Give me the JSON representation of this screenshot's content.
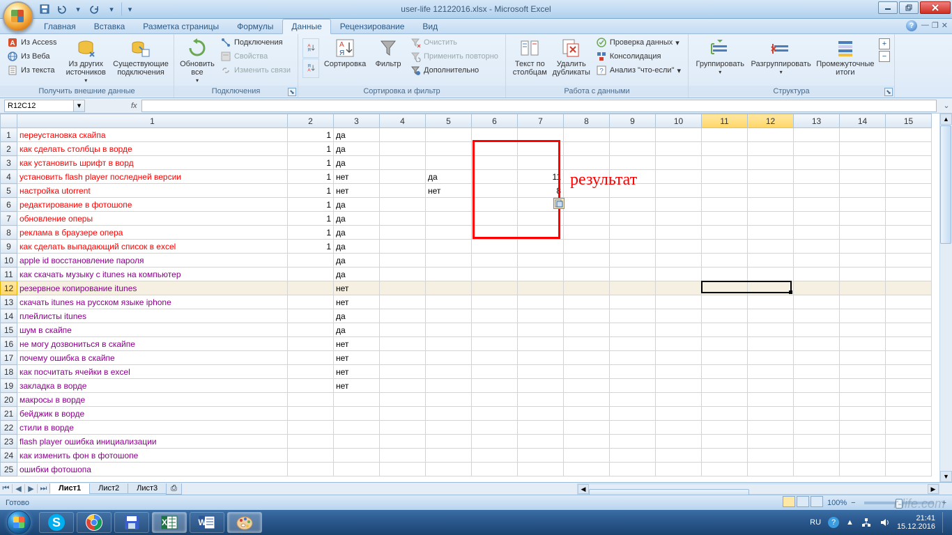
{
  "title": "user-life 12122016.xlsx - Microsoft Excel",
  "qat": {
    "save": "save",
    "undo": "undo",
    "redo": "redo"
  },
  "tabs": {
    "items": [
      {
        "label": "Главная"
      },
      {
        "label": "Вставка"
      },
      {
        "label": "Разметка страницы"
      },
      {
        "label": "Формулы"
      },
      {
        "label": "Данные"
      },
      {
        "label": "Рецензирование"
      },
      {
        "label": "Вид"
      }
    ],
    "active": 4
  },
  "ribbon": {
    "g1": {
      "access": "Из Access",
      "web": "Из Веба",
      "text": "Из текста",
      "other": "Из других источников",
      "existing": "Существующие подключения",
      "label": "Получить внешние данные"
    },
    "g2": {
      "refresh": "Обновить все",
      "conns": "Подключения",
      "props": "Свойства",
      "edit": "Изменить связи",
      "label": "Подключения"
    },
    "g3": {
      "az": "А↓Я",
      "za": "Я↓А",
      "sort": "Сортировка",
      "filter": "Фильтр",
      "clear": "Очистить",
      "reapply": "Применить повторно",
      "advanced": "Дополнительно",
      "label": "Сортировка и фильтр"
    },
    "g4": {
      "ttc": "Текст по столбцам",
      "dup": "Удалить дубликаты",
      "valid": "Проверка данных",
      "consol": "Консолидация",
      "whatif": "Анализ \"что-если\"",
      "label": "Работа с данными"
    },
    "g5": {
      "group": "Группировать",
      "ungroup": "Разгруппировать",
      "subtotal": "Промежуточные итоги",
      "label": "Структура"
    }
  },
  "namebox": "R12C12",
  "fx": "fx",
  "columns": [
    "",
    "1",
    "2",
    "3",
    "4",
    "5",
    "6",
    "7",
    "8",
    "9",
    "10",
    "11",
    "12",
    "13",
    "14",
    "15"
  ],
  "rows": [
    {
      "n": "1",
      "a": "переустановка скайпа",
      "cls": "c-red",
      "c2": "1",
      "c3": "да"
    },
    {
      "n": "2",
      "a": "как сделать столбцы в ворде",
      "cls": "c-red",
      "c2": "1",
      "c3": "да"
    },
    {
      "n": "3",
      "a": "как установить шрифт в ворд",
      "cls": "c-red",
      "c2": "1",
      "c3": "да"
    },
    {
      "n": "4",
      "a": "установить flash player последней версии",
      "cls": "c-red",
      "c2": "1",
      "c3": "нет",
      "c5": "да",
      "c7": "11"
    },
    {
      "n": "5",
      "a": "настройка utorrent",
      "cls": "c-red",
      "c2": "1",
      "c3": "нет",
      "c5": "нет",
      "c7": "8"
    },
    {
      "n": "6",
      "a": "редактирование в фотошопе",
      "cls": "c-red",
      "c2": "1",
      "c3": "да"
    },
    {
      "n": "7",
      "a": "обновление оперы",
      "cls": "c-red",
      "c2": "1",
      "c3": "да"
    },
    {
      "n": "8",
      "a": "реклама в браузере опера",
      "cls": "c-red",
      "c2": "1",
      "c3": "да"
    },
    {
      "n": "9",
      "a": "как сделать выпадающий список в excel",
      "cls": "c-red",
      "c2": "1",
      "c3": "да"
    },
    {
      "n": "10",
      "a": "apple id восстановление пароля",
      "cls": "c-purple",
      "c3": "да"
    },
    {
      "n": "11",
      "a": "как скачать музыку с itunes на компьютер",
      "cls": "c-purple",
      "c3": "да"
    },
    {
      "n": "12",
      "a": "резервное копирование itunes",
      "cls": "c-purple",
      "c3": "нет",
      "sel": true
    },
    {
      "n": "13",
      "a": "скачать itunes на русском языке iphone",
      "cls": "c-purple",
      "c3": "нет"
    },
    {
      "n": "14",
      "a": "плейлисты itunes",
      "cls": "c-purple",
      "c3": "да"
    },
    {
      "n": "15",
      "a": "шум в скайпе",
      "cls": "c-purple",
      "c3": "да"
    },
    {
      "n": "16",
      "a": "не могу дозвониться в скайпе",
      "cls": "c-purple",
      "c3": "нет"
    },
    {
      "n": "17",
      "a": "почему ошибка в скайпе",
      "cls": "c-purple",
      "c3": "нет"
    },
    {
      "n": "18",
      "a": "как посчитать ячейки в excel",
      "cls": "c-purple",
      "c3": "нет"
    },
    {
      "n": "19",
      "a": "закладка в ворде",
      "cls": "c-purple",
      "c3": "нет"
    },
    {
      "n": "20",
      "a": "макросы в ворде",
      "cls": "c-purple"
    },
    {
      "n": "21",
      "a": "бейджик в ворде",
      "cls": "c-purple"
    },
    {
      "n": "22",
      "a": "стили в ворде",
      "cls": "c-purple"
    },
    {
      "n": "23",
      "a": "flash player ошибка инициализации",
      "cls": "c-purple"
    },
    {
      "n": "24",
      "a": "как изменить фон в фотошопе",
      "cls": "c-purple"
    },
    {
      "n": "25",
      "a": "ошибки фотошопа",
      "cls": "c-purple"
    }
  ],
  "annotation": "результат",
  "sheets": {
    "items": [
      "Лист1",
      "Лист2",
      "Лист3"
    ],
    "active": 0
  },
  "status": {
    "ready": "Готово",
    "zoom": "100%",
    "minus": "−",
    "plus": "+"
  },
  "tray": {
    "lang": "RU",
    "time": "21:41",
    "date": "15.12.2016"
  },
  "watermark": "r-life.com"
}
